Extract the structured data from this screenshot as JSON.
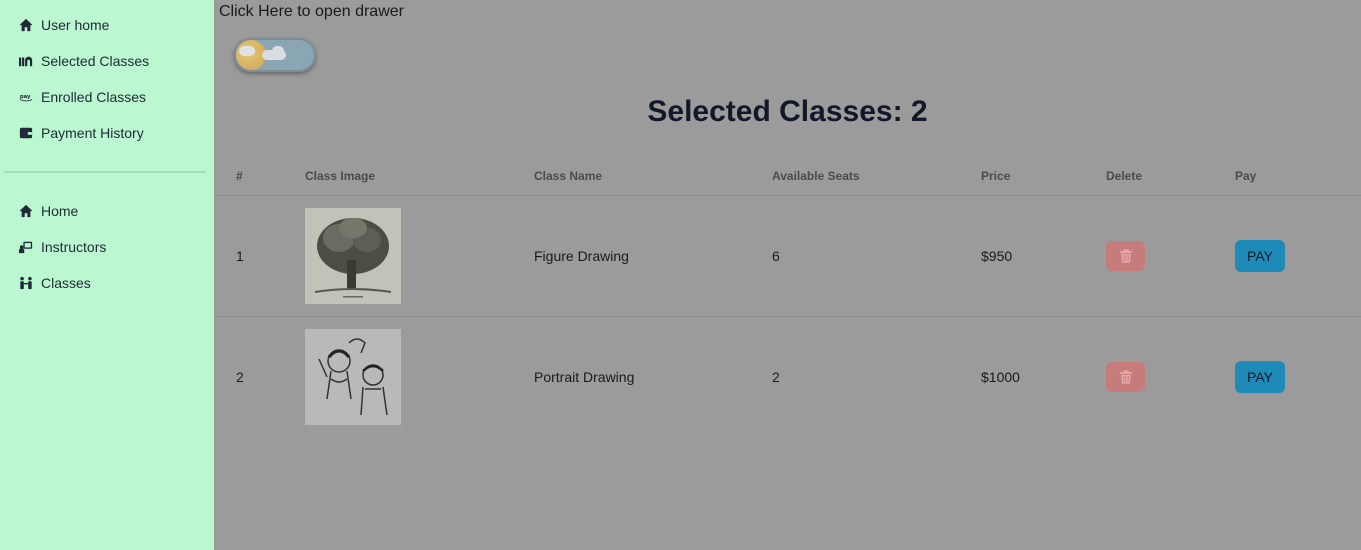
{
  "sidebar": {
    "items_top": [
      {
        "label": "User home",
        "icon": "home-icon"
      },
      {
        "label": "Selected Classes",
        "icon": "classes-icon"
      },
      {
        "label": "Enrolled Classes",
        "icon": "pay-icon"
      },
      {
        "label": "Payment History",
        "icon": "wallet-icon"
      }
    ],
    "items_bottom": [
      {
        "label": "Home",
        "icon": "home-icon"
      },
      {
        "label": "Instructors",
        "icon": "instructor-icon"
      },
      {
        "label": "Classes",
        "icon": "people-icon"
      }
    ]
  },
  "main": {
    "drawer_link": "Click Here to open drawer",
    "title": "Selected Classes: 2",
    "table": {
      "headers": [
        "#",
        "Class Image",
        "Class Name",
        "Available Seats",
        "Price",
        "Delete",
        "Pay"
      ],
      "rows": [
        {
          "index": "1",
          "image": "tree-drawing",
          "name": "Figure Drawing",
          "seats": "6",
          "price": "$950",
          "pay_label": "PAY"
        },
        {
          "index": "2",
          "image": "children-drawing",
          "name": "Portrait Drawing",
          "seats": "2",
          "price": "$1000",
          "pay_label": "PAY"
        }
      ]
    }
  },
  "colors": {
    "sidebar_bg": "#bbf7d0",
    "overlay_bg": "#9b9b9b",
    "delete_button": "#c77c7c",
    "pay_button": "#1e8ab7"
  }
}
